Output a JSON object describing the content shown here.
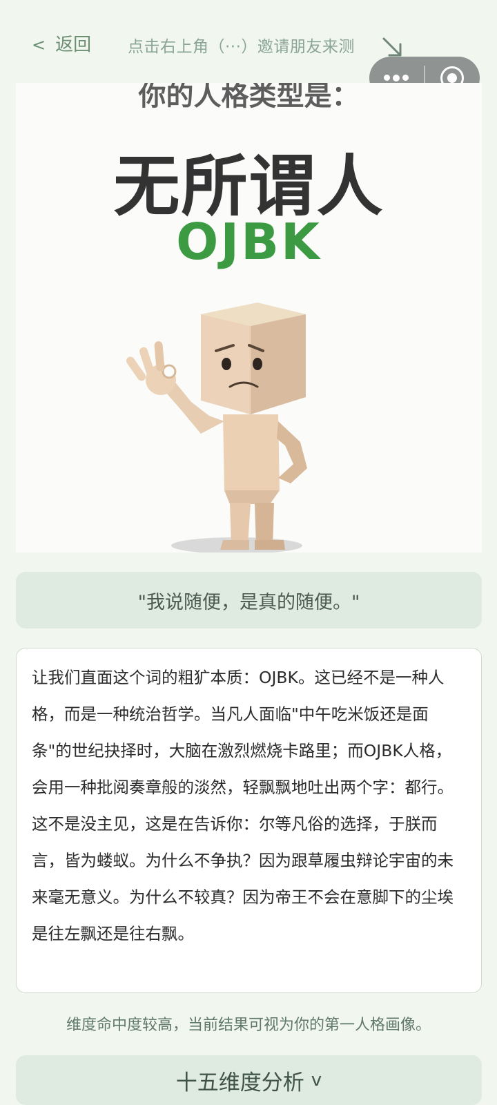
{
  "nav": {
    "back_label": "返回",
    "back_icon": "chevron-left-icon",
    "share_hint": "点击右上角（···）邀请朋友来测",
    "hint_arrow_icon": "arrow-down-right-icon"
  },
  "capsule": {
    "more_icon": "more-dots-icon",
    "close_icon": "target-close-icon"
  },
  "result": {
    "kicker": "你的人格类型是：",
    "type_name": "无所谓人",
    "type_code": "OJBK",
    "image_icon": "ok-hand-figure-illustration"
  },
  "quote": "\"我说随便，是真的随便。\"",
  "description": "让我们直面这个词的粗犷本质：OJBK。这已经不是一种人格，而是一种统治哲学。当凡人面临\"中午吃米饭还是面条\"的世纪抉择时，大脑在激烈燃烧卡路里；而OJBK人格，会用一种批阅奏章般的淡然，轻飘飘地吐出两个字：都行。这不是没主见，这是在告诉你：尔等凡俗的选择，于朕而言，皆为蝼蚁。为什么不争执？因为跟草履虫辩论宇宙的未来毫无意义。为什么不较真？因为帝王不会在意脚下的尘埃是往左飘还是往右飘。",
  "note": "维度命中度较高，当前结果可视为你的第一人格画像。",
  "dimensions": {
    "label": "十五维度分析",
    "caret": "v"
  },
  "colors": {
    "background": "#f1f6ef",
    "panel": "#dfeae0",
    "accent_green": "#3b9a42",
    "link": "#6c8f74"
  }
}
